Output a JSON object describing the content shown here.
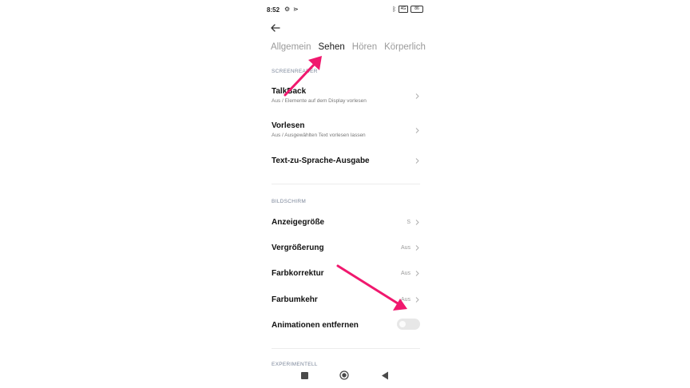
{
  "status_bar": {
    "time": "8:52",
    "battery": "86",
    "sim_label": "4G"
  },
  "tabs": [
    {
      "label": "Allgemein"
    },
    {
      "label": "Sehen"
    },
    {
      "label": "Hören"
    },
    {
      "label": "Körperlich"
    }
  ],
  "sections": {
    "screenreader": "SCREENREADER",
    "bildschirm": "BILDSCHIRM",
    "experimentell": "EXPERIMENTELL"
  },
  "rows": {
    "talkback": {
      "title": "TalkBack",
      "subtitle": "Aus / Elemente auf dem Display vorlesen"
    },
    "vorlesen": {
      "title": "Vorlesen",
      "subtitle": "Aus / Ausgewählten Text vorlesen lassen"
    },
    "tts": {
      "title": "Text-zu-Sprache-Ausgabe"
    },
    "anzeigegroesse": {
      "title": "Anzeigegröße",
      "value": "S"
    },
    "vergroesserung": {
      "title": "Vergrößerung",
      "value": "Aus"
    },
    "farbkorrektur": {
      "title": "Farbkorrektur",
      "value": "Aus"
    },
    "farbumkehr": {
      "title": "Farbumkehr",
      "value": "Aus"
    },
    "animationen": {
      "title": "Animationen entfernen",
      "enabled": false
    }
  },
  "icons": {
    "back": "arrow-left-icon",
    "chevron": "chevron-right-icon",
    "annotation_arrow_color": "#F0186E"
  }
}
